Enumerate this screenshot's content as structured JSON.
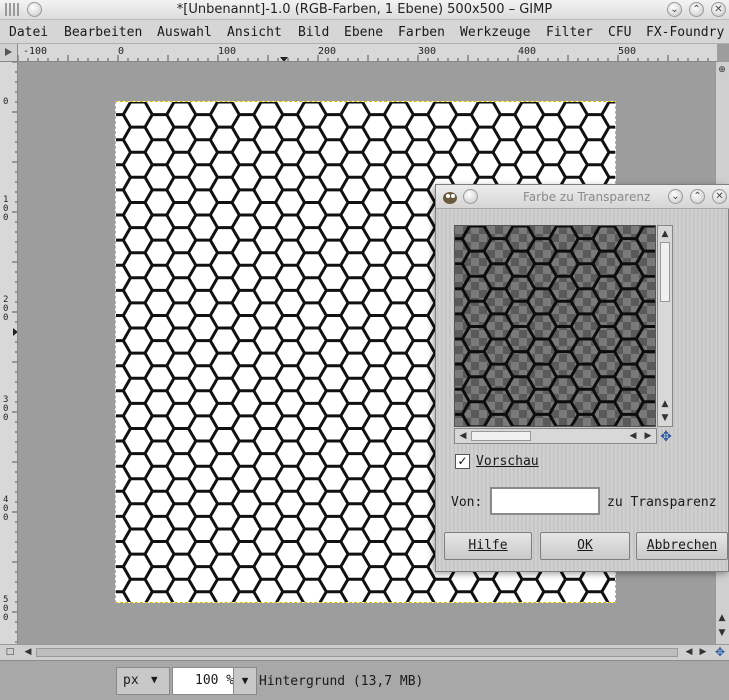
{
  "window": {
    "title": "*[Unbenannt]-1.0 (RGB-Farben, 1 Ebene) 500x500 – GIMP"
  },
  "menu": [
    "Datei",
    "Bearbeiten",
    "Auswahl",
    "Ansicht",
    "Bild",
    "Ebene",
    "Farben",
    "Werkzeuge",
    "Filter",
    "CFU",
    "FX-Foundry"
  ],
  "ruler": {
    "horizontal_ticks": [
      "-100",
      "0",
      "100",
      "200",
      "300",
      "400",
      "500"
    ],
    "vertical_ticks": [
      "0",
      "100",
      "200",
      "300",
      "400",
      "500"
    ]
  },
  "statusbar": {
    "unit": "px",
    "zoom": "100 %",
    "layer_info": "Hintergrund (13,7 MB)"
  },
  "dialog": {
    "title": "Farbe zu Transparenz",
    "preview_label": "Vorschau",
    "preview_checked": true,
    "from_label": "Von:",
    "to_label": "zu Transparenz",
    "buttons": {
      "help": "Hilfe",
      "ok": "OK",
      "cancel": "Abbrechen"
    }
  },
  "icons": {
    "window_controls": [
      "chevron-down-icon",
      "chevron-up-icon",
      "close-icon"
    ],
    "dialog_logo": "gimp-wilber-icon",
    "navigate": "move-cross-icon"
  },
  "colors": {
    "canvas_bg": "#ffffff",
    "hex_stroke": "#111111",
    "selection_border": "#d8c000",
    "checker_dark": "#5a5a5a",
    "checker_light": "#7a7a7a"
  }
}
